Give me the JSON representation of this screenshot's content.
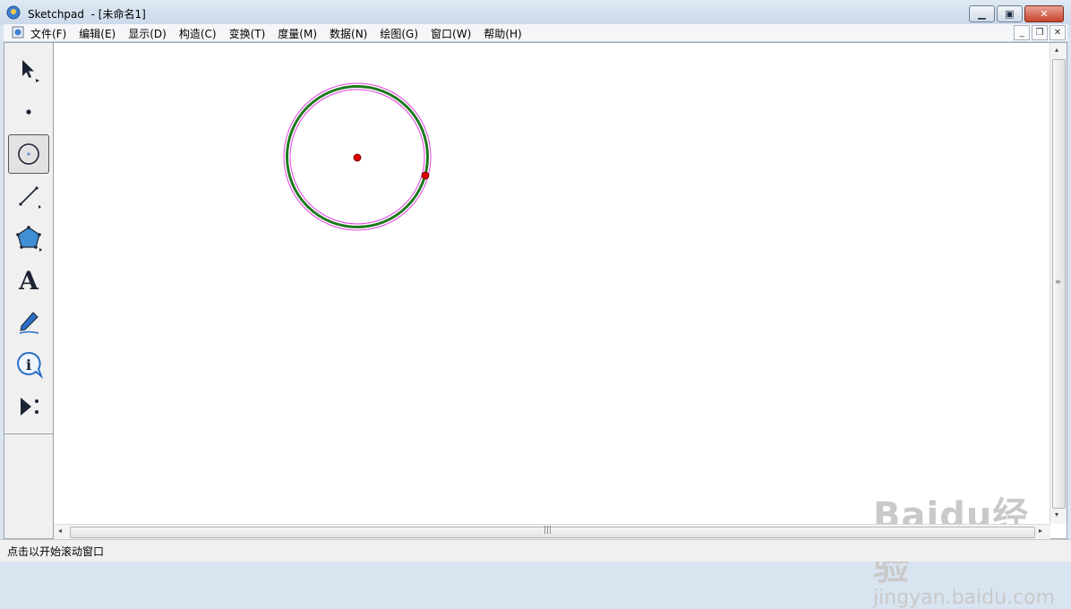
{
  "window": {
    "title": "Sketchpad  - [未命名1]",
    "minimize_label": "▁",
    "maximize_label": "▣",
    "close_label": "✕"
  },
  "menubar": {
    "items": [
      "文件(F)",
      "编辑(E)",
      "显示(D)",
      "构造(C)",
      "变换(T)",
      "度量(M)",
      "数据(N)",
      "绘图(G)",
      "窗口(W)",
      "帮助(H)"
    ],
    "mdi_minimize": "_",
    "mdi_restore": "❐",
    "mdi_close": "✕"
  },
  "toolbox": {
    "tools": [
      "selection-arrow",
      "point",
      "compass",
      "straightedge",
      "polygon",
      "text",
      "marker",
      "information",
      "custom"
    ],
    "active_tool": "compass",
    "text_tool_glyph": "A"
  },
  "canvas": {
    "circle_color": "#1f7a1f",
    "highlight_color": "#e040e0",
    "point_color": "#e00000"
  },
  "scroll": {
    "grip": "|||",
    "left_arrow": "◂",
    "right_arrow": "▸",
    "up_arrow": "▴",
    "down_arrow": "▾"
  },
  "status": {
    "text": "点击以开始滚动窗口"
  },
  "watermark": {
    "brand": "Baidu经验",
    "url": "jingyan.baidu.com"
  }
}
